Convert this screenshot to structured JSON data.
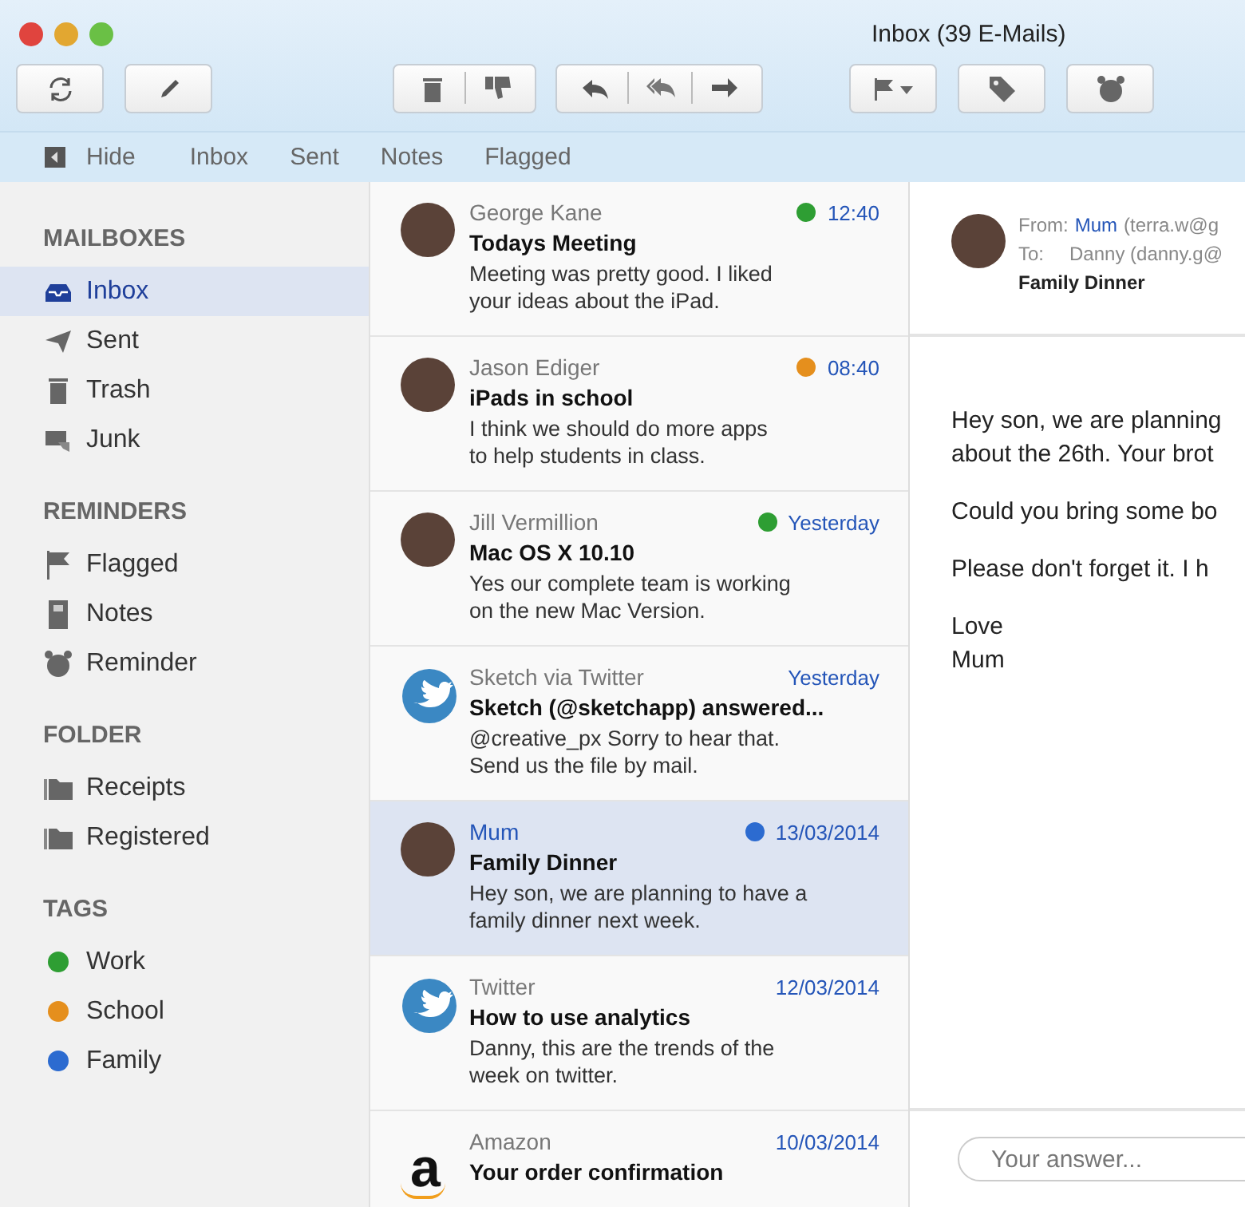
{
  "window": {
    "title": "Inbox (39 E-Mails)"
  },
  "tab_bar": {
    "hide_label": "Hide",
    "tabs": [
      "Inbox",
      "Sent",
      "Notes",
      "Flagged"
    ]
  },
  "sidebar": {
    "sections": [
      {
        "title": "MAILBOXES",
        "items": [
          {
            "label": "Inbox",
            "selected": true
          },
          {
            "label": "Sent",
            "selected": false
          },
          {
            "label": "Trash",
            "selected": false
          },
          {
            "label": "Junk",
            "selected": false
          }
        ]
      },
      {
        "title": "REMINDERS",
        "items": [
          {
            "label": "Flagged",
            "selected": false
          },
          {
            "label": "Notes",
            "selected": false
          },
          {
            "label": "Reminder",
            "selected": false
          }
        ]
      },
      {
        "title": "FOLDER",
        "items": [
          {
            "label": "Receipts",
            "selected": false
          },
          {
            "label": "Registered",
            "selected": false
          }
        ]
      },
      {
        "title": "TAGS",
        "items": [
          {
            "label": "Work",
            "selected": false,
            "color": "#2e9e33"
          },
          {
            "label": "School",
            "selected": false,
            "color": "#e58f1d"
          },
          {
            "label": "Family",
            "selected": false,
            "color": "#2c6bd0"
          }
        ]
      }
    ]
  },
  "messages": [
    {
      "kind": "photo",
      "sender": "George Kane",
      "time": "12:40",
      "color": "#2e9e33",
      "subject": "Todays Meeting",
      "preview": [
        "Meeting was pretty good. I liked",
        "your ideas about the iPad."
      ],
      "selected": false
    },
    {
      "kind": "photo",
      "sender": "Jason Ediger",
      "time": "08:40",
      "color": "#e58f1d",
      "subject": "iPads in school",
      "preview": [
        "I think we should do more apps",
        "to help students in class."
      ],
      "selected": false
    },
    {
      "kind": "photo",
      "sender": "Jill Vermillion",
      "time": "Yesterday",
      "color": "#2e9e33",
      "subject": "Mac OS X 10.10",
      "preview": [
        "Yes our complete team is working",
        "on the new Mac Version."
      ],
      "selected": false
    },
    {
      "kind": "bird",
      "sender": "Sketch via Twitter",
      "time": "Yesterday",
      "subject": "Sketch (@sketchapp) answered...",
      "preview": [
        "@creative_px Sorry to hear that.",
        "Send us the file by mail."
      ],
      "selected": false
    },
    {
      "kind": "photo",
      "sender": "Mum",
      "time": "13/03/2014",
      "color": "#2c6bd0",
      "subject": "Family Dinner",
      "preview": [
        "Hey son, we are planning to have a",
        "family dinner next week."
      ],
      "selected": true
    },
    {
      "kind": "bird",
      "sender": "Twitter",
      "time": "12/03/2014",
      "subject": "How to use analytics",
      "preview": [
        "Danny, this are the trends of the",
        "week on twitter."
      ],
      "selected": false
    },
    {
      "kind": "letter",
      "logo_text": "a",
      "sender": "Amazon",
      "time": "10/03/2014",
      "subject": "Your order confirmation",
      "selected": false
    }
  ],
  "reader": {
    "from_label": "From:",
    "from_name": "Mum",
    "from_address": "(terra.w@g",
    "to_label": "To:",
    "to": "Danny (danny.g@",
    "subject": "Family Dinner",
    "body": [
      [
        "Hey son, we are planning",
        "about the 26th. Your brot"
      ],
      [
        "Could you bring some bo"
      ],
      [
        "Please don't forget it. I h"
      ],
      [
        "Love",
        "Mum"
      ]
    ],
    "reply": {
      "placeholder": "Your answer..."
    }
  }
}
